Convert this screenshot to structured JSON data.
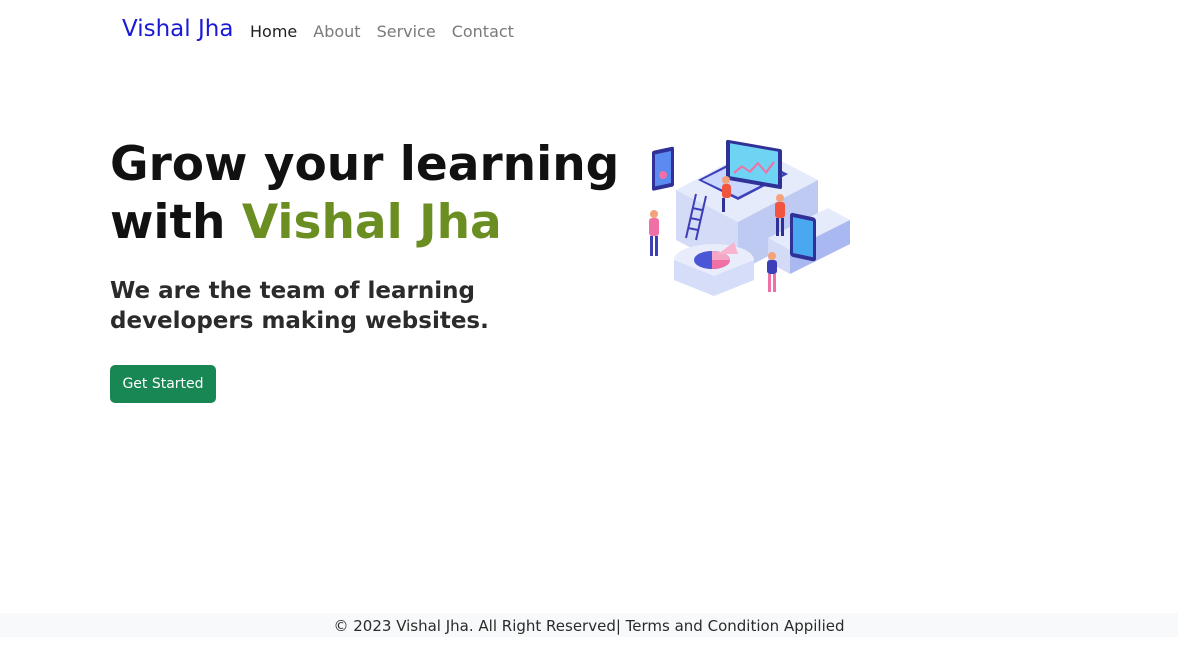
{
  "nav": {
    "brand": "Vishal Jha",
    "links": [
      {
        "label": "Home",
        "active": true
      },
      {
        "label": "About",
        "active": false
      },
      {
        "label": "Service",
        "active": false
      },
      {
        "label": "Contact",
        "active": false
      }
    ]
  },
  "hero": {
    "title_line1": "Grow your learning",
    "title_line2_prefix": "with ",
    "title_line2_accent": "Vishal Jha",
    "subtitle": "We are the team of learning developers making websites.",
    "cta_label": "Get Started"
  },
  "illustration": {
    "icon": "isometric-team-dashboard-illustration"
  },
  "footer": {
    "text": "© 2023 Vishal Jha. All Right Reserved| Terms and Condition Appilied"
  },
  "colors": {
    "brand": "#1a1ad6",
    "accent": "#6b8e23",
    "cta": "#198754",
    "footer_bg": "#f8f9fa"
  }
}
